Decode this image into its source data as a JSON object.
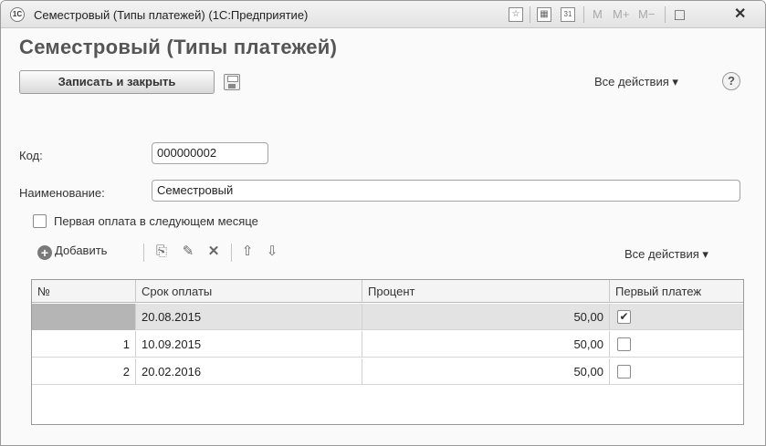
{
  "window": {
    "app_icon_text": "1С",
    "title": "Семестровый (Типы платежей)  (1С:Предприятие)",
    "controls": {
      "m": "M",
      "m_plus": "M+",
      "m_minus": "M−",
      "restore": "□",
      "close": "✕"
    }
  },
  "form": {
    "title": "Семестровый (Типы платежей)",
    "save_close_label": "Записать и закрыть",
    "all_actions_label": "Все действия ▾",
    "help_label": "?"
  },
  "fields": {
    "code_label": "Код:",
    "code_value": "000000002",
    "name_label": "Наименование:",
    "name_value": "Семестровый",
    "first_payment_label": "Первая оплата в следующем месяце",
    "first_payment_checked": false
  },
  "table_toolbar": {
    "add_label": "Добавить",
    "all_actions_label": "Все действия ▾"
  },
  "table": {
    "columns": [
      "№",
      "Срок оплаты",
      "Процент",
      "Первый платеж"
    ],
    "rows": [
      {
        "num": "",
        "date": "20.08.2015",
        "percent": "50,00",
        "first": "✔"
      },
      {
        "num": "1",
        "date": "10.09.2015",
        "percent": "50,00",
        "first": ""
      },
      {
        "num": "2",
        "date": "20.02.2016",
        "percent": "50,00",
        "first": ""
      }
    ]
  }
}
